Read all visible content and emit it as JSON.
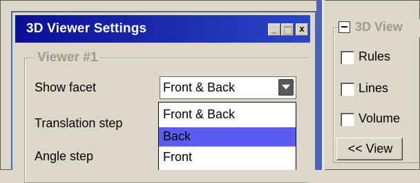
{
  "window": {
    "title": "3D Viewer Settings",
    "close_glyph": "x"
  },
  "viewer_group": {
    "legend": "Viewer #1",
    "show_facet_label": "Show facet",
    "translation_step_label": "Translation step",
    "angle_step_label": "Angle step",
    "show_facet_value": "Front & Back",
    "options": [
      "Front & Back",
      "Back",
      "Front"
    ],
    "highlighted_option": "Back"
  },
  "right_panel": {
    "legend": "3D View",
    "checkboxes": [
      {
        "label": "Rules",
        "checked": false
      },
      {
        "label": "Lines",
        "checked": false
      },
      {
        "label": "Volume",
        "checked": false
      }
    ],
    "view_button": "<< View"
  },
  "colors": {
    "title_bar": "#0a0e96",
    "selection": "#5c5cf2",
    "dialog_face": "#dcd7c7"
  }
}
